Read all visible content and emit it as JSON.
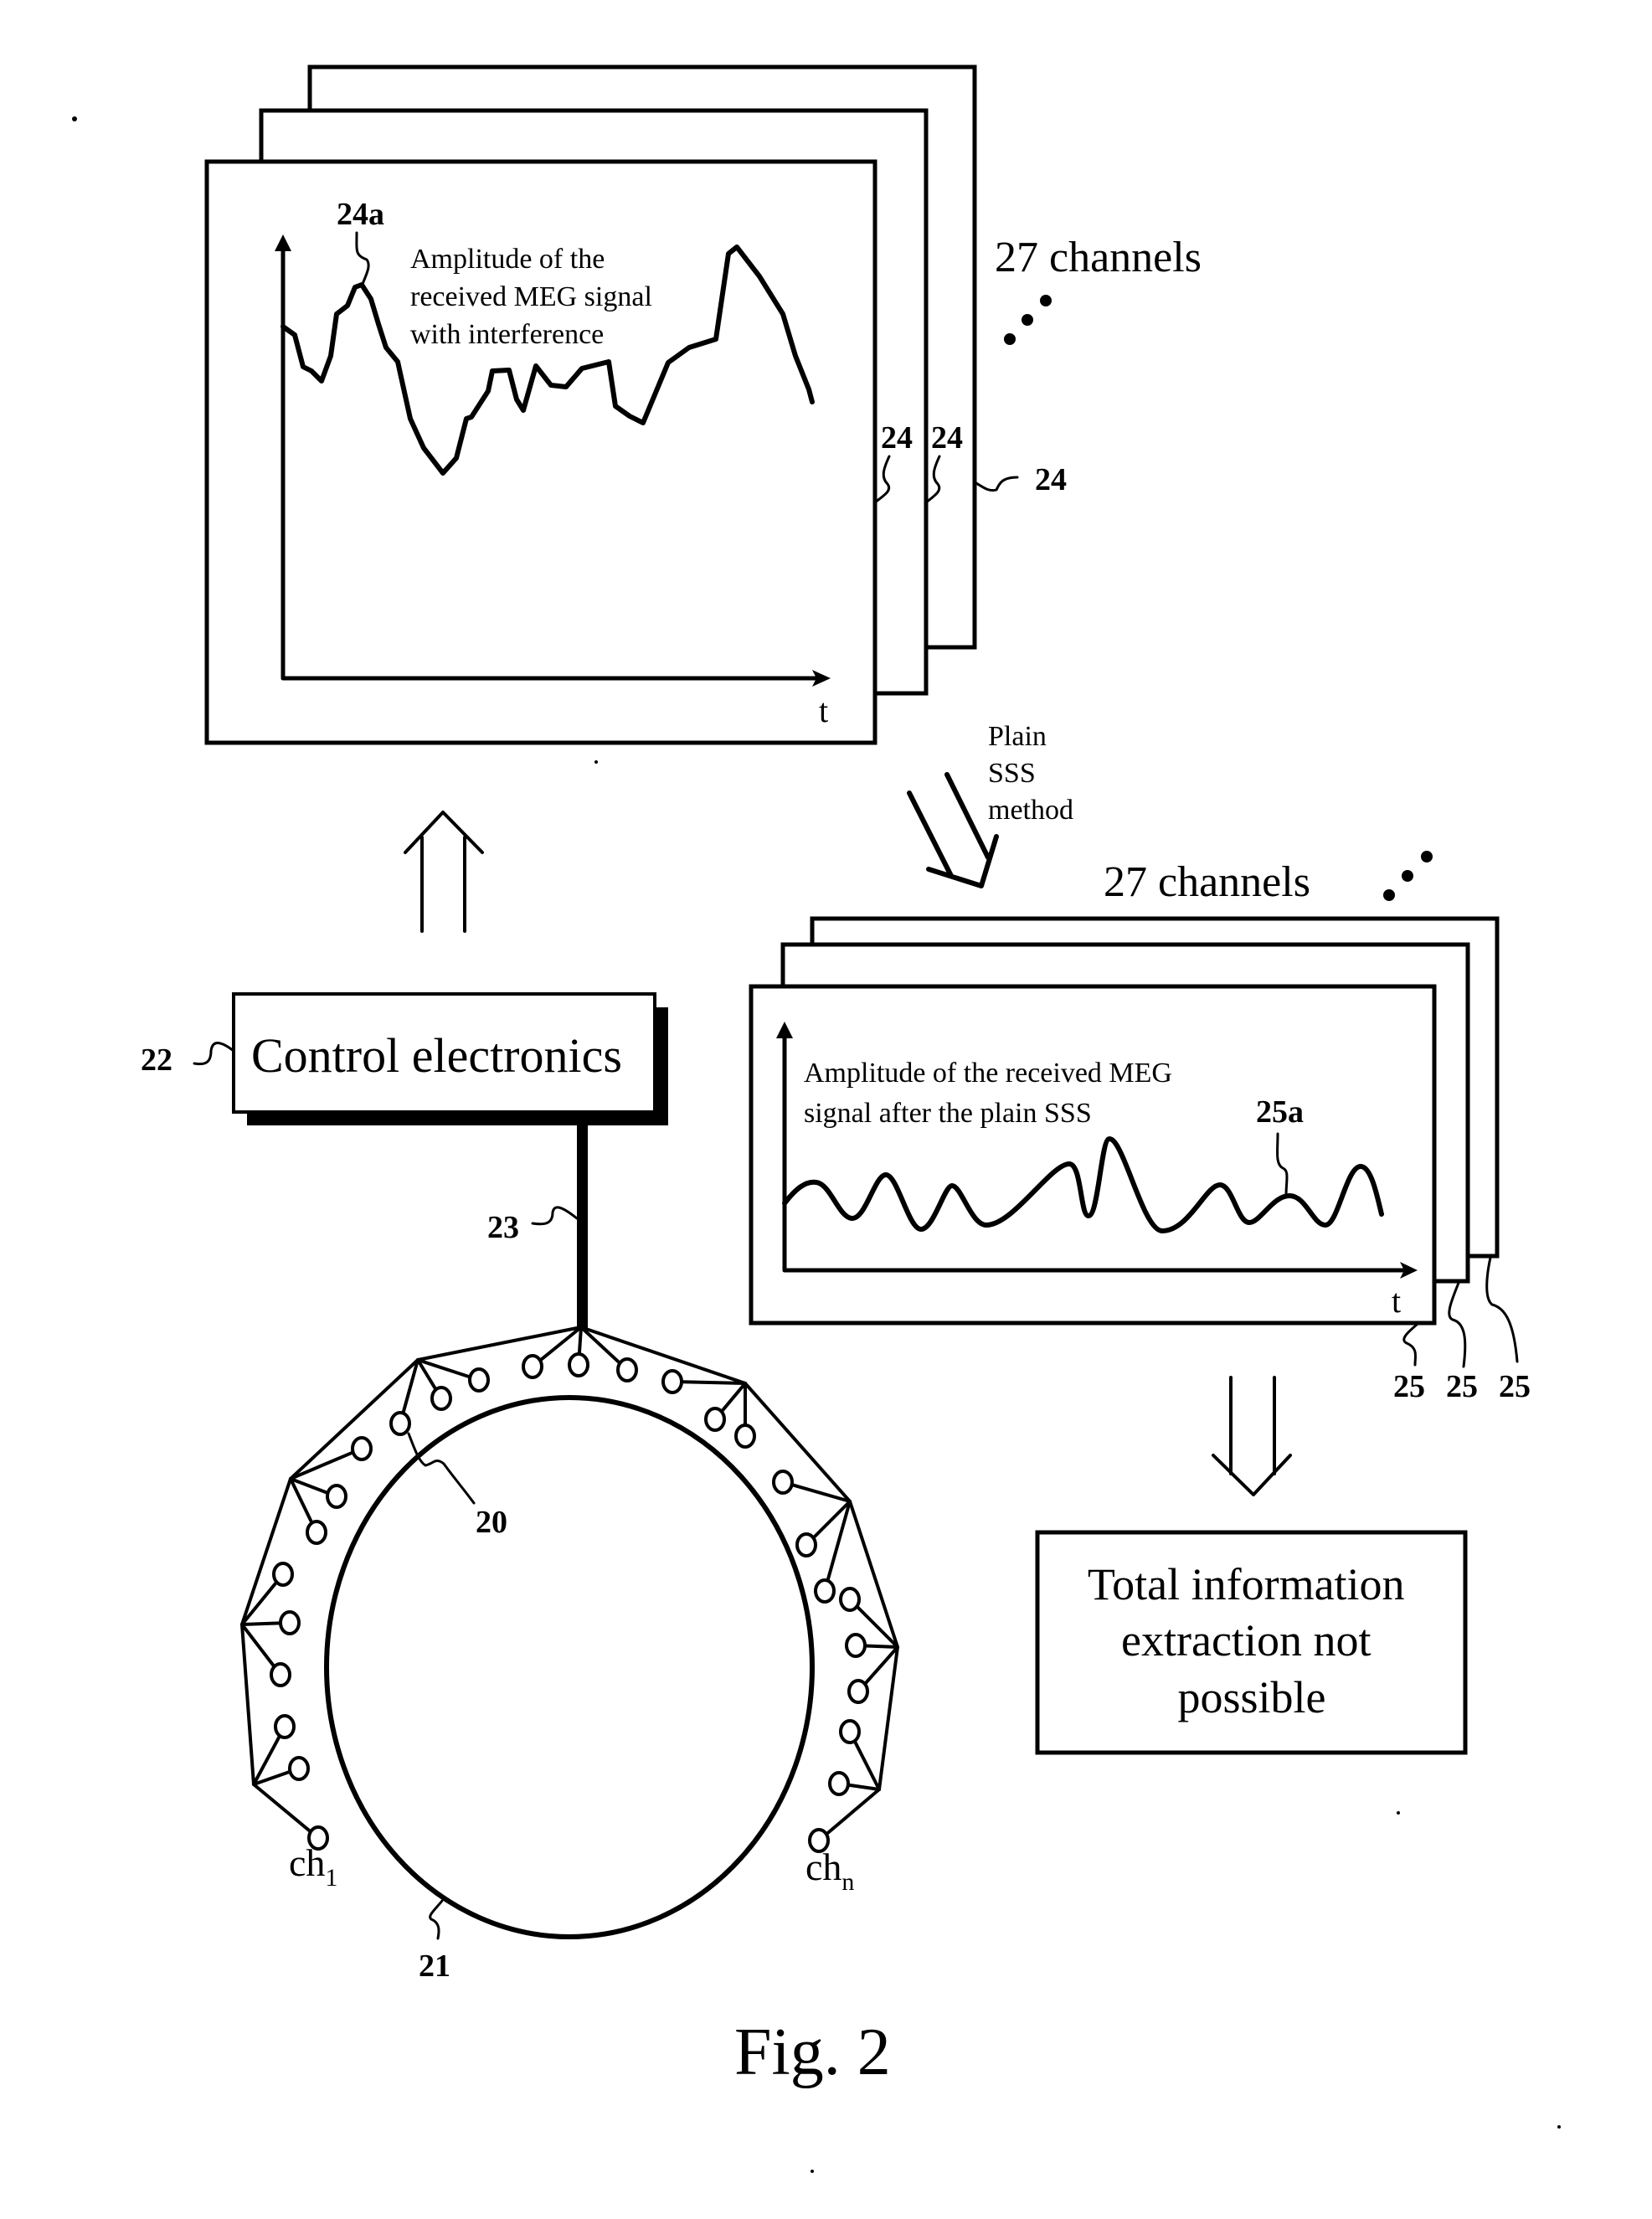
{
  "figure": {
    "caption": "Fig. 2",
    "colors": {
      "ink": "#000000",
      "paper": "#ffffff"
    }
  },
  "raw_panel": {
    "channels_label": "27 channels",
    "signal_label_lines": [
      "Amplitude of the",
      "received MEG signal",
      "with interference"
    ],
    "signal_ref": "24a",
    "frame_refs": [
      "24",
      "24",
      "24"
    ],
    "time_axis_label": "t"
  },
  "processing": {
    "method_label_lines": [
      "Plain",
      "SSS",
      "method"
    ]
  },
  "sss_panel": {
    "channels_label": "27 channels",
    "signal_label_lines": [
      "Amplitude of the received MEG",
      "signal after the plain SSS"
    ],
    "signal_ref": "25a",
    "frame_refs": [
      "25",
      "25",
      "25"
    ],
    "time_axis_label": "t"
  },
  "control": {
    "box_label": "Control electronics",
    "box_ref": "22",
    "cable_ref": "23"
  },
  "sensor_array": {
    "sensor_ref": "20",
    "head_ref": "21",
    "first_channel": {
      "base": "ch",
      "sub": "1"
    },
    "last_channel": {
      "base": "ch",
      "sub": "n"
    }
  },
  "result": {
    "box_lines": [
      "Total information",
      "extraction not",
      "possible"
    ]
  }
}
